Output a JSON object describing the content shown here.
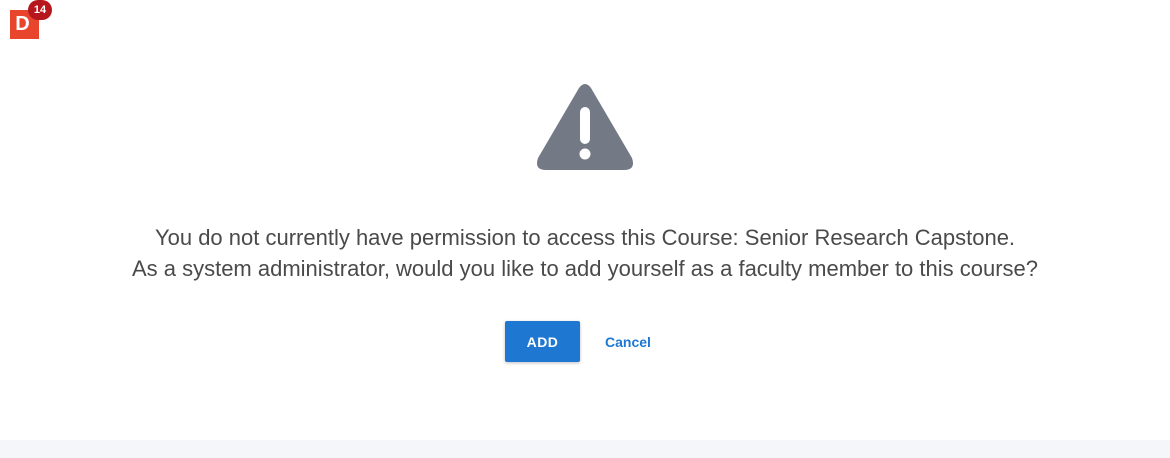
{
  "app": {
    "logo_letter": "D",
    "notification_count": "14",
    "brand_color": "#e8452c",
    "badge_color": "#b5171d"
  },
  "alert": {
    "icon": "warning-triangle-icon",
    "icon_color": "#737985",
    "message_line1": "You do not currently have permission to access this Course: Senior Research Capstone.",
    "message_line2": "As a system administrator, would you like to add yourself as a faculty member to this course?"
  },
  "actions": {
    "add_label": "ADD",
    "cancel_label": "Cancel",
    "accent_color": "#1e78d2"
  }
}
